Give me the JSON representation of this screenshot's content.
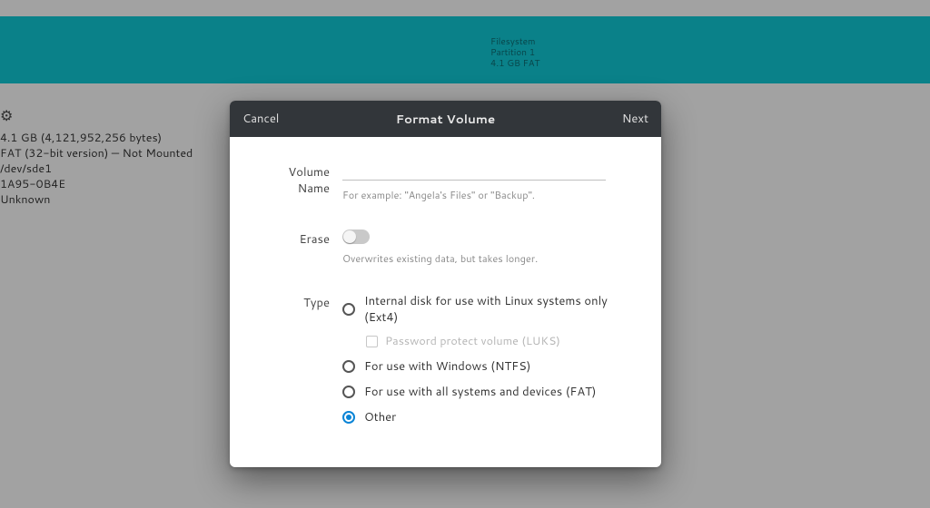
{
  "background": {
    "band": {
      "line1": "Filesystem",
      "line2": "Partition 1",
      "line3": "4.1 GB FAT"
    },
    "info": {
      "size": "4.1 GB (4,121,952,256 bytes)",
      "fs": "FAT (32-bit version) — Not Mounted",
      "device": "/dev/sde1",
      "uuid": "1A95-0B4E",
      "partition_type": "Unknown"
    }
  },
  "dialog": {
    "cancel": "Cancel",
    "title": "Format Volume",
    "next": "Next",
    "fields": {
      "volume_name_label": "Volume Name",
      "volume_name_value": "",
      "volume_name_hint": "For example: \"Angela's Files\" or \"Backup\".",
      "erase_label": "Erase",
      "erase_hint": "Overwrites existing data, but takes longer.",
      "type_label": "Type"
    },
    "type_options": {
      "ext4": "Internal disk for use with Linux systems only (Ext4)",
      "luks": "Password protect volume (LUKS)",
      "ntfs": "For use with Windows (NTFS)",
      "fat": "For use with all systems and devices (FAT)",
      "other": "Other"
    }
  }
}
